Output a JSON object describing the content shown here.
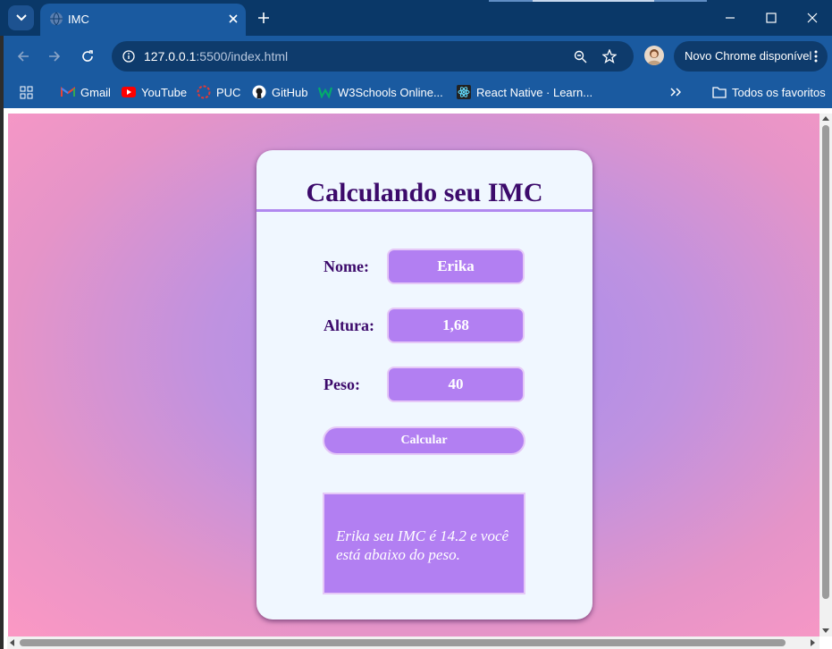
{
  "browser": {
    "tab": {
      "title": "IMC"
    },
    "url": {
      "host": "127.0.0.1",
      "rest": ":5500/index.html"
    },
    "update_label": "Novo Chrome disponível",
    "bookmarks": [
      {
        "label": "Gmail",
        "icon": "gmail-icon"
      },
      {
        "label": "YouTube",
        "icon": "youtube-icon"
      },
      {
        "label": "PUC",
        "icon": "puc-icon"
      },
      {
        "label": "GitHub",
        "icon": "github-icon"
      },
      {
        "label": "W3Schools Online...",
        "icon": "w3schools-icon"
      },
      {
        "label": "React Native · Learn...",
        "icon": "react-icon"
      }
    ],
    "all_bookmarks_label": "Todos os favoritos"
  },
  "page": {
    "title": "Calculando seu IMC",
    "fields": [
      {
        "label": "Nome:",
        "value": "Erika"
      },
      {
        "label": "Altura:",
        "value": "1,68"
      },
      {
        "label": "Peso:",
        "value": "40"
      }
    ],
    "button_label": "Calcular",
    "result": "Erika seu IMC é 14.2 e você está abaixo do peso."
  },
  "colors": {
    "browser_frame": "#1a5aa0",
    "card_bg": "#f0f7ff",
    "title": "#3c0a6b",
    "input_bg": "#b27ff2",
    "gradient_center": "#a58cef",
    "gradient_edge": "#fb98c4"
  }
}
